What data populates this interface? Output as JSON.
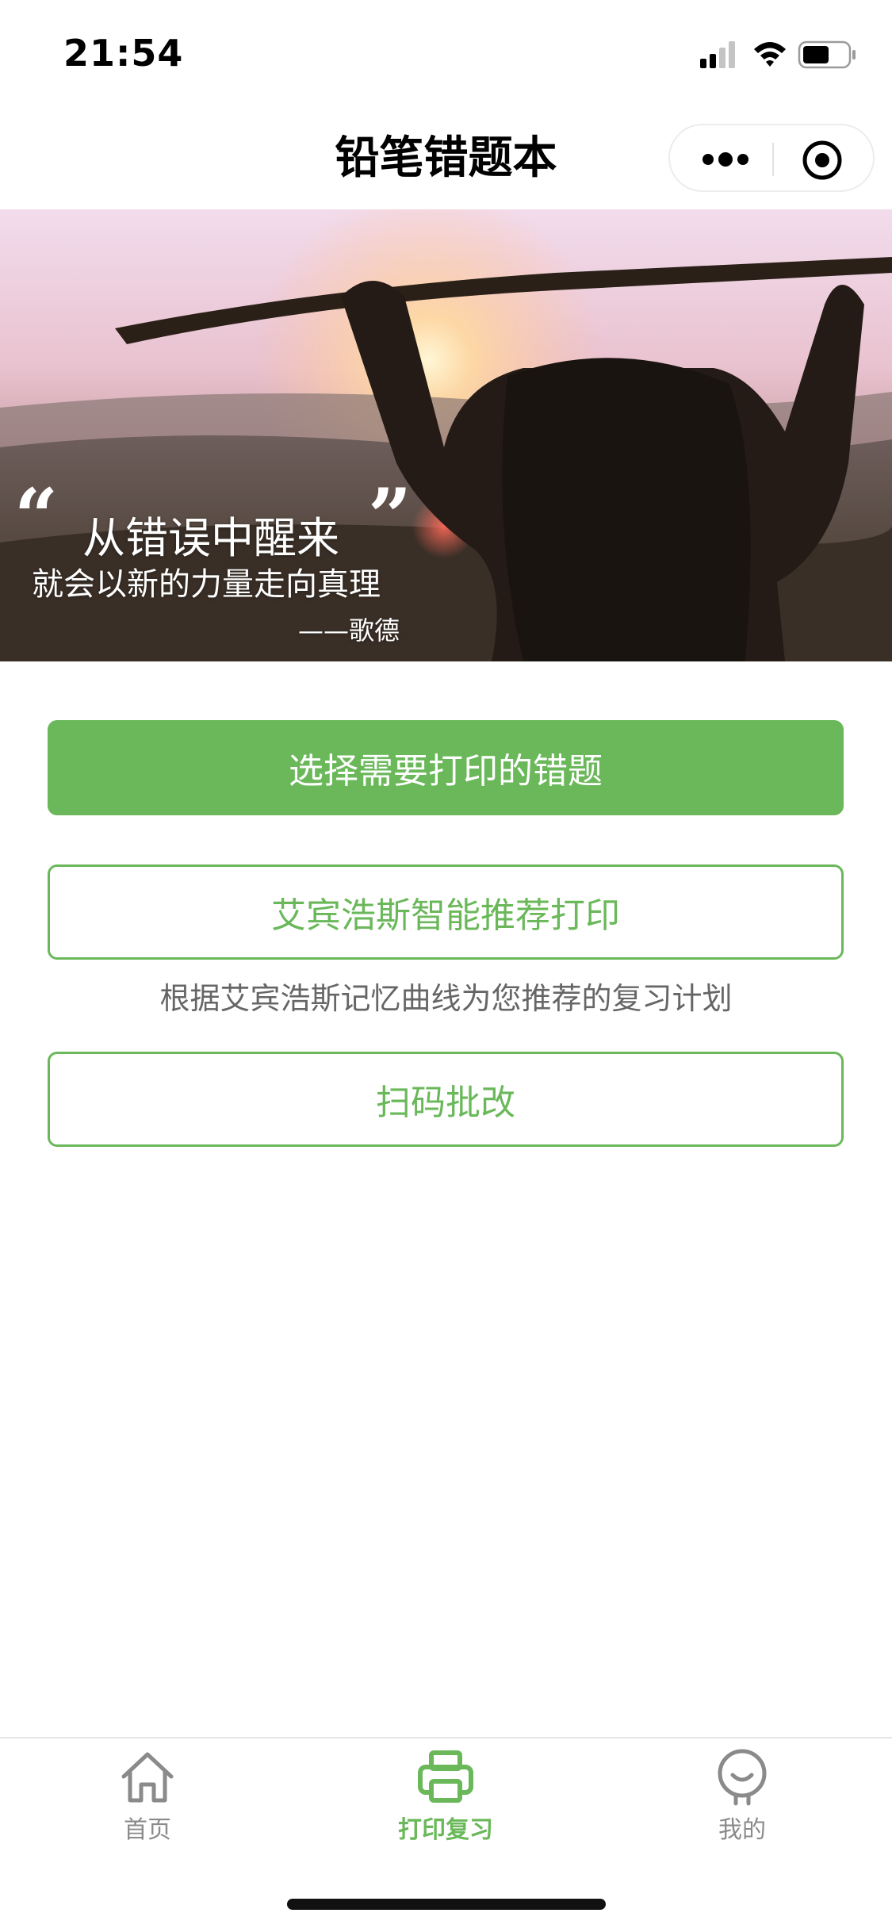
{
  "status_bar": {
    "time": "21:54",
    "icons": [
      "signal-icon",
      "wifi-icon",
      "battery-icon"
    ]
  },
  "nav": {
    "title": "铅笔错题本",
    "capsule_icons": [
      "more-dots-icon",
      "close-target-icon"
    ]
  },
  "banner": {
    "quote_open": "“",
    "quote_close": "”",
    "line1": "从错误中醒来",
    "line2": "就会以新的力量走向真理",
    "author": "——歌德"
  },
  "actions": {
    "select_print_label": "选择需要打印的错题",
    "ebbinghaus_label": "艾宾浩斯智能推荐打印",
    "ebbinghaus_hint": "根据艾宾浩斯记忆曲线为您推荐的复习计划",
    "scan_label": "扫码批改"
  },
  "tabbar": {
    "items": [
      {
        "label": "首页",
        "icon": "home-icon",
        "active": false
      },
      {
        "label": "打印复习",
        "icon": "printer-icon",
        "active": true
      },
      {
        "label": "我的",
        "icon": "profile-icon",
        "active": false
      }
    ]
  },
  "colors": {
    "accent": "#6ab85a",
    "inactive": "#8a8a8a",
    "hint_text": "#666666"
  }
}
